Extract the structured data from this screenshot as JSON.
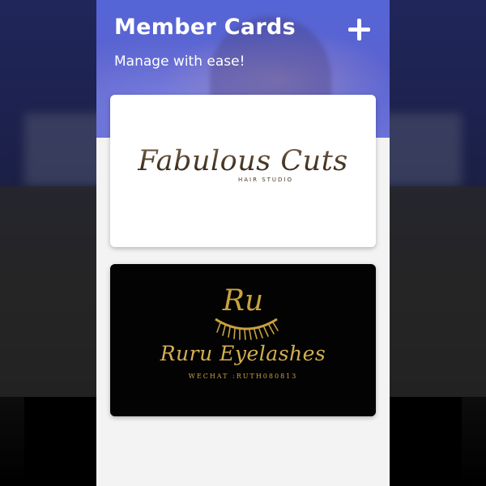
{
  "header": {
    "title": "Member Cards",
    "subtitle": "Manage with ease!",
    "add_icon": "plus-icon"
  },
  "cards": [
    {
      "name": "Fabulous Cuts",
      "tagline": "HAIR STUDIO",
      "background": "#ffffff",
      "text_color": "#4a3a28"
    },
    {
      "monogram": "Ru",
      "name": "Ruru Eyelashes",
      "tagline": "WECHAT :RUTH080813",
      "background": "#030303",
      "text_color": "#c9a23f",
      "logo_icon": "eyelash-icon"
    }
  ],
  "colors": {
    "hero_blue": "#5b63d0",
    "page_bg": "#f3f3f4",
    "gold": "#c9a23f"
  }
}
